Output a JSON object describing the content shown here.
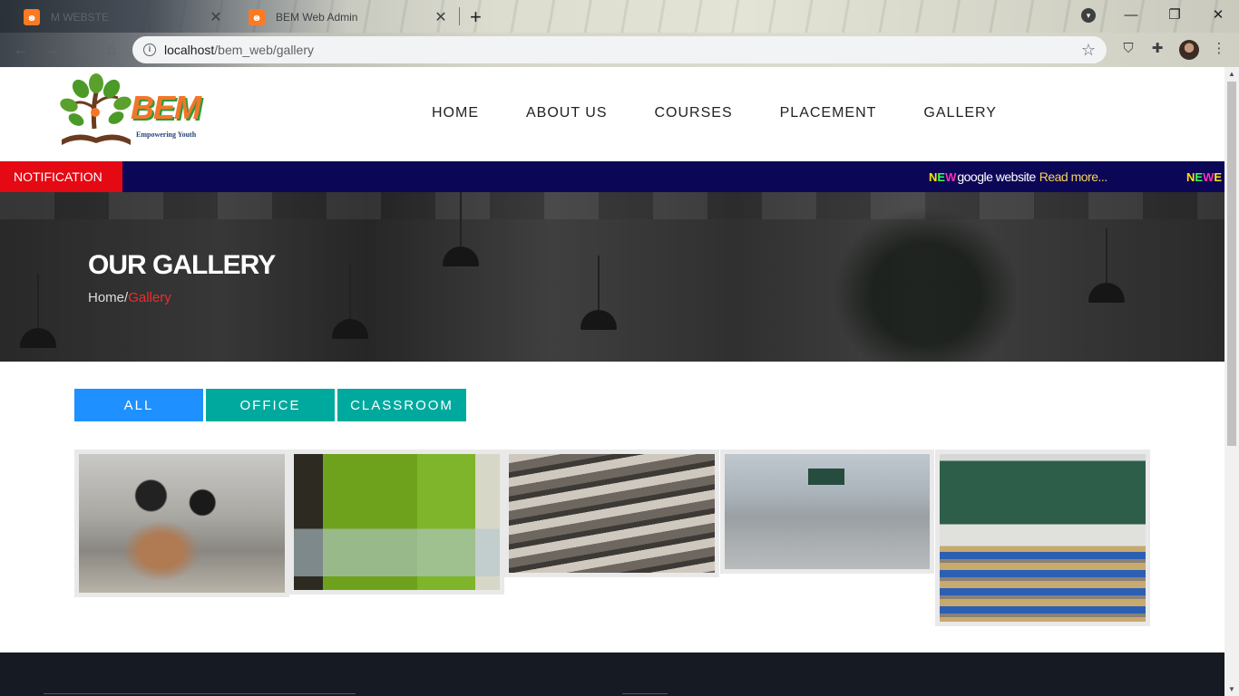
{
  "browser": {
    "tabs": [
      {
        "title": "M WEBSTE",
        "icon": "xampp-icon",
        "active": false
      },
      {
        "title": "BEM Web Admin",
        "icon": "xampp-icon",
        "active": true
      }
    ],
    "url_host": "localhost",
    "url_path": "/bem_web/gallery",
    "new_tab_label": "+",
    "close_label": "✕"
  },
  "site": {
    "logo_text": "BEM",
    "logo_tagline": "Empowering Youth",
    "nav": [
      "HOME",
      "ABOUT US",
      "COURSES",
      "PLACEMENT",
      "GALLERY"
    ],
    "notification_label": "NOTIFICATION",
    "ticker": {
      "badge": [
        "N",
        "E",
        "W"
      ],
      "text": "google website",
      "link": "Read more...",
      "badge2": [
        "N",
        "E",
        "W",
        "E"
      ]
    },
    "hero_title": "OUR GALLERY",
    "breadcrumb_home": "Home/",
    "breadcrumb_current": "Gallery",
    "filters": [
      "ALL",
      "OFFICE",
      "CLASSROOM"
    ],
    "gallery": [
      {
        "category": "office",
        "name": "office-photo-1"
      },
      {
        "category": "office",
        "name": "office-photo-2"
      },
      {
        "category": "classroom",
        "name": "classroom-photo-1"
      },
      {
        "category": "classroom",
        "name": "classroom-photo-2"
      },
      {
        "category": "classroom",
        "name": "classroom-photo-3"
      }
    ]
  },
  "colors": {
    "notification_bg": "#0c0657",
    "notification_label_bg": "#e50914",
    "filter_active": "#1e90ff",
    "filter_inactive": "#00a99d",
    "breadcrumb_active": "#ef2b2b",
    "footer_bg": "#161a22"
  }
}
